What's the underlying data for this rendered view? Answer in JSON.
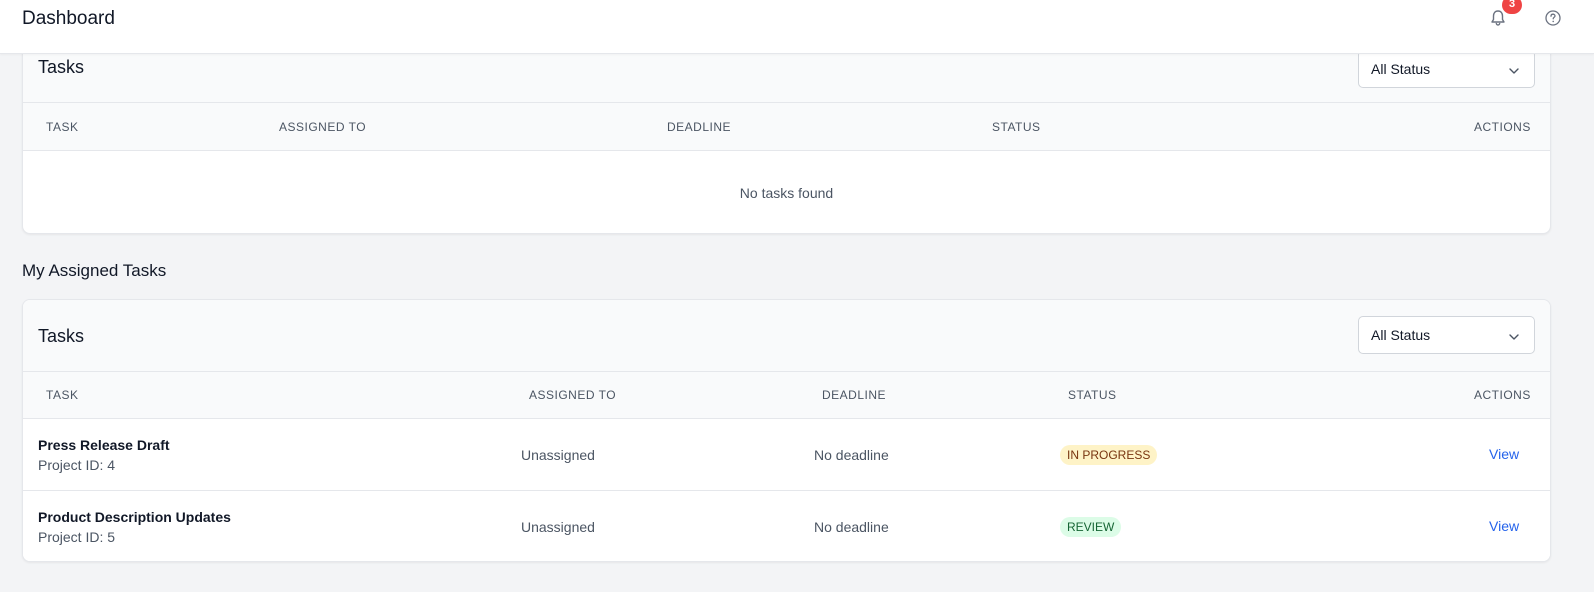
{
  "header": {
    "title": "Dashboard",
    "notification_count": "3",
    "bell_icon": "bell-icon",
    "help_icon": "help-circle-icon"
  },
  "tasks_card": {
    "title": "Tasks",
    "filter": {
      "selected": "All Status"
    },
    "columns": [
      "TASK",
      "ASSIGNED TO",
      "DEADLINE",
      "STATUS",
      "ACTIONS"
    ],
    "empty_message": "No tasks found"
  },
  "assigned_section": {
    "title": "My Assigned Tasks",
    "card_title": "Tasks",
    "filter": {
      "selected": "All Status"
    },
    "columns": [
      "TASK",
      "ASSIGNED TO",
      "DEADLINE",
      "STATUS",
      "ACTIONS"
    ],
    "rows": [
      {
        "name": "Press Release Draft",
        "project": "Project ID: 4",
        "assigned": "Unassigned",
        "deadline": "No deadline",
        "status": "IN PROGRESS",
        "status_color": "#fef3c7",
        "action": "View"
      },
      {
        "name": "Product Description Updates",
        "project": "Project ID: 5",
        "assigned": "Unassigned",
        "deadline": "No deadline",
        "status": "REVIEW",
        "status_color": "#dcfce7",
        "action": "View"
      }
    ]
  },
  "colors": {
    "page_bg": "#f3f4f6",
    "card_bg": "#ffffff",
    "link": "#2563eb",
    "badge": "#ef4444"
  }
}
